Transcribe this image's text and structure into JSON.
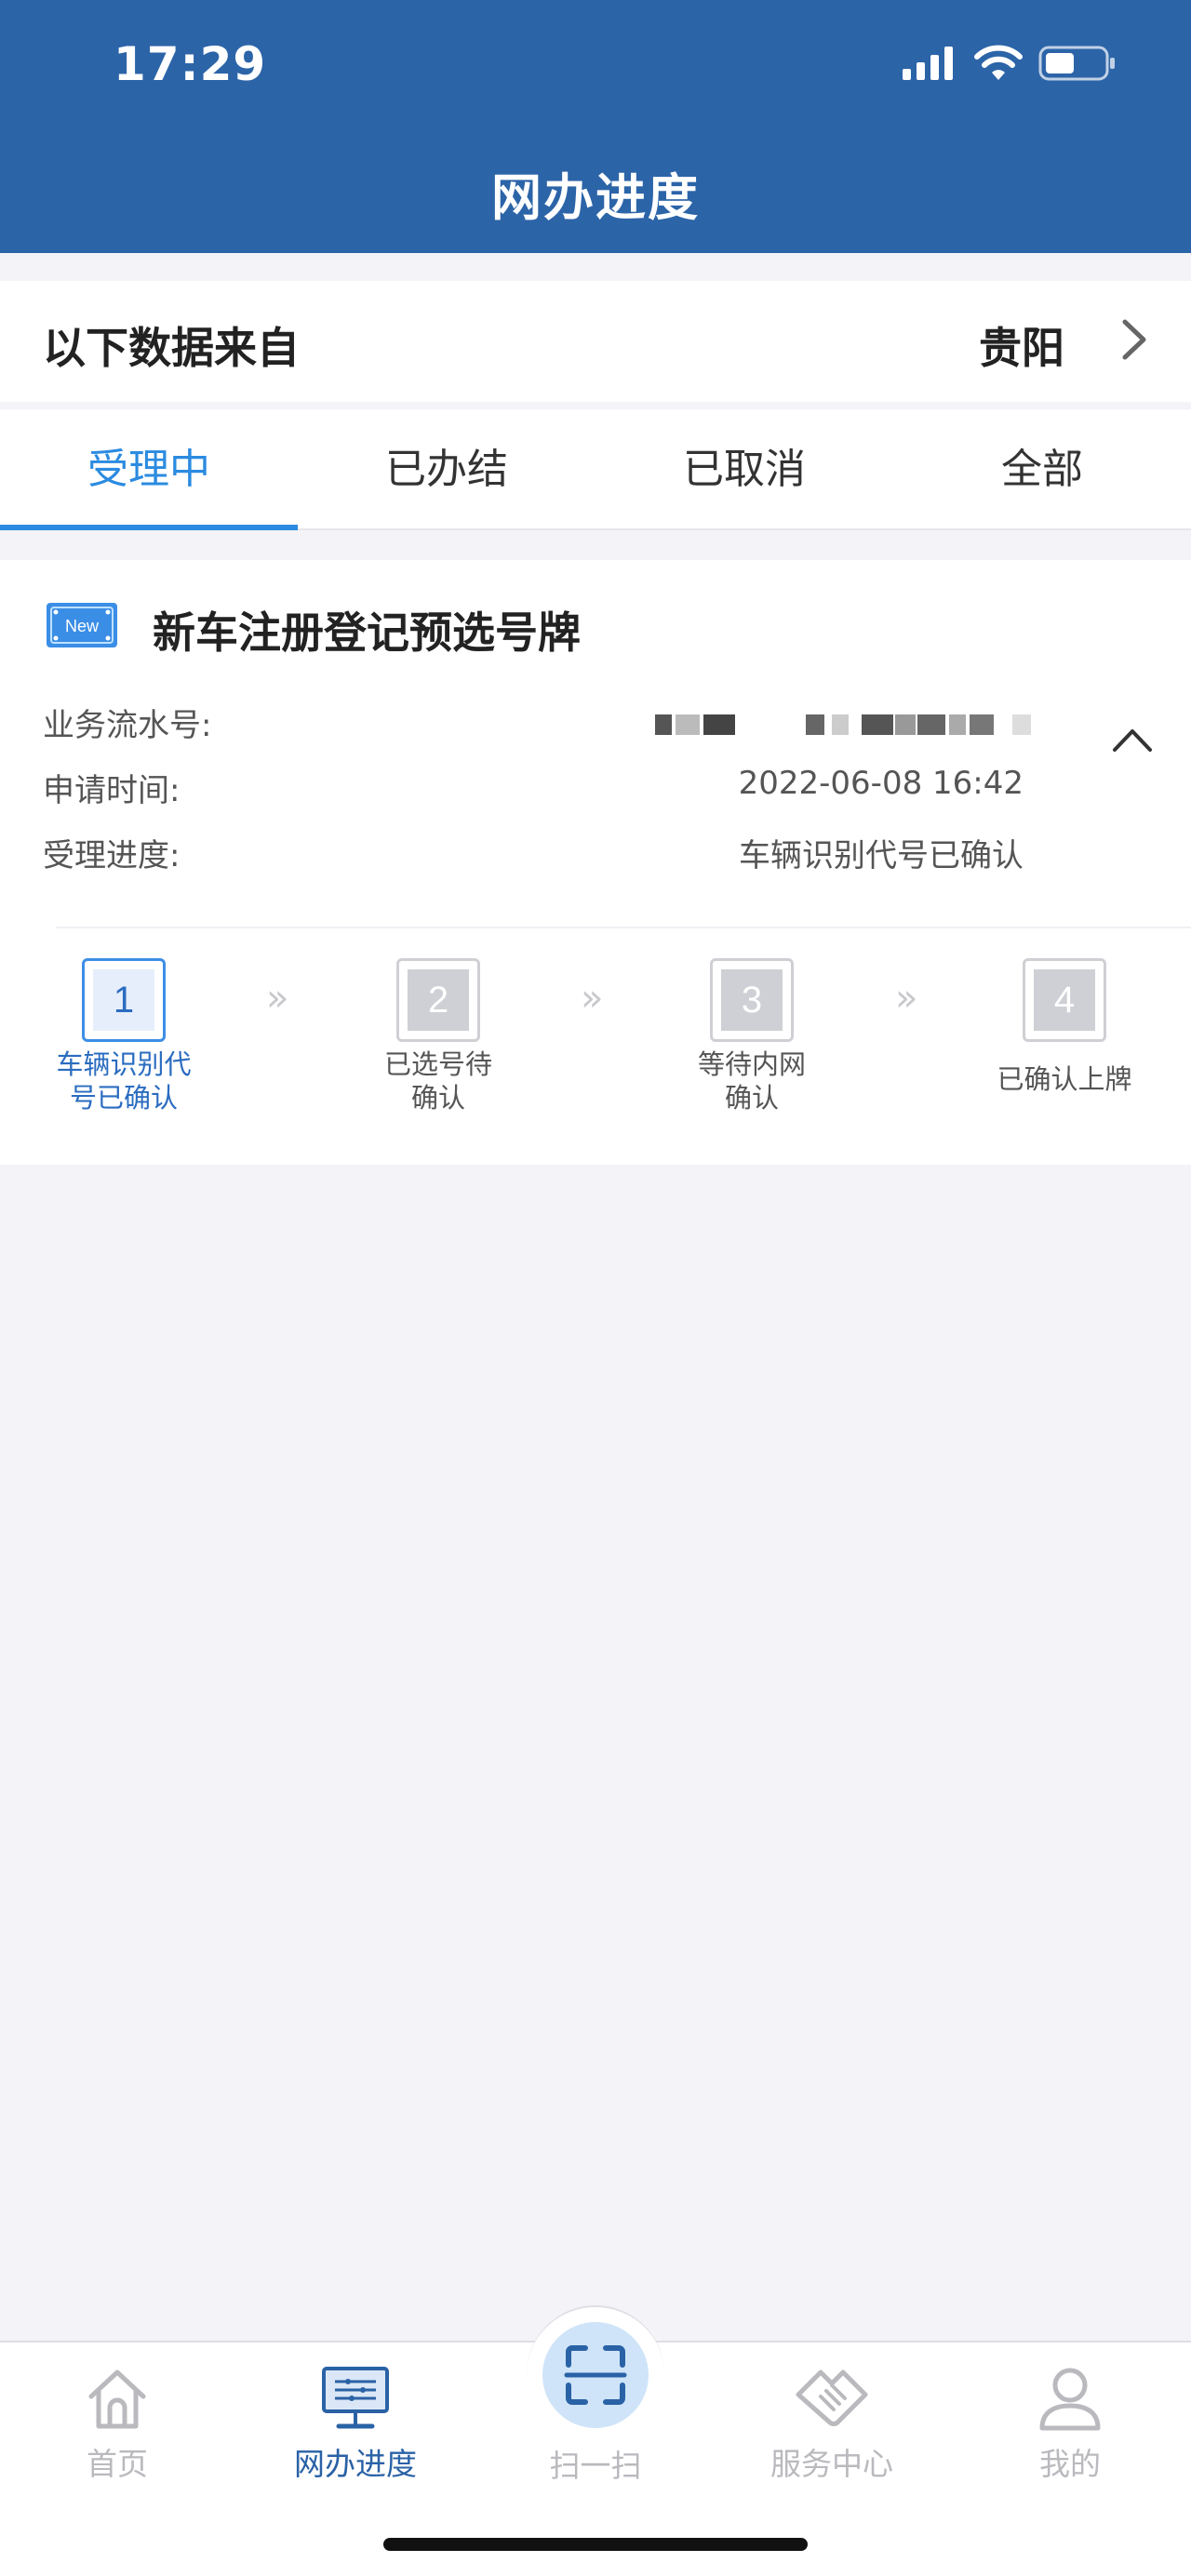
{
  "status_bar": {
    "time": "17:29"
  },
  "header": {
    "title": "网办进度"
  },
  "source": {
    "label": "以下数据来自",
    "city": "贵阳"
  },
  "tabs": [
    {
      "label": "受理中",
      "active": true
    },
    {
      "label": "已办结",
      "active": false
    },
    {
      "label": "已取消",
      "active": false
    },
    {
      "label": "全部",
      "active": false
    }
  ],
  "card": {
    "badge": "New",
    "title": "新车注册登记预选号牌",
    "serial_label": "业务流水号:",
    "time_label": "申请时间:",
    "time_value": "2022-06-08 16:42",
    "progress_label": "受理进度:",
    "progress_value": "车辆识别代号已确认",
    "steps": [
      {
        "num": "1",
        "line1": "车辆识别代",
        "line2": "号已确认",
        "active": true
      },
      {
        "num": "2",
        "line1": "已选号待",
        "line2": "确认",
        "active": false
      },
      {
        "num": "3",
        "line1": "等待内网",
        "line2": "确认",
        "active": false
      },
      {
        "num": "4",
        "line1": "已确认上牌",
        "line2": "",
        "active": false
      }
    ],
    "step_arrow": "»"
  },
  "tabbar": {
    "home": "首页",
    "progress": "网办进度",
    "scan": "扫一扫",
    "service": "服务中心",
    "mine": "我的"
  },
  "colors": {
    "header_bg": "#2c64a8",
    "tab_active": "#2b8be0",
    "tabbar_active": "#2a62a6",
    "page_bg": "#f3f3f8"
  }
}
